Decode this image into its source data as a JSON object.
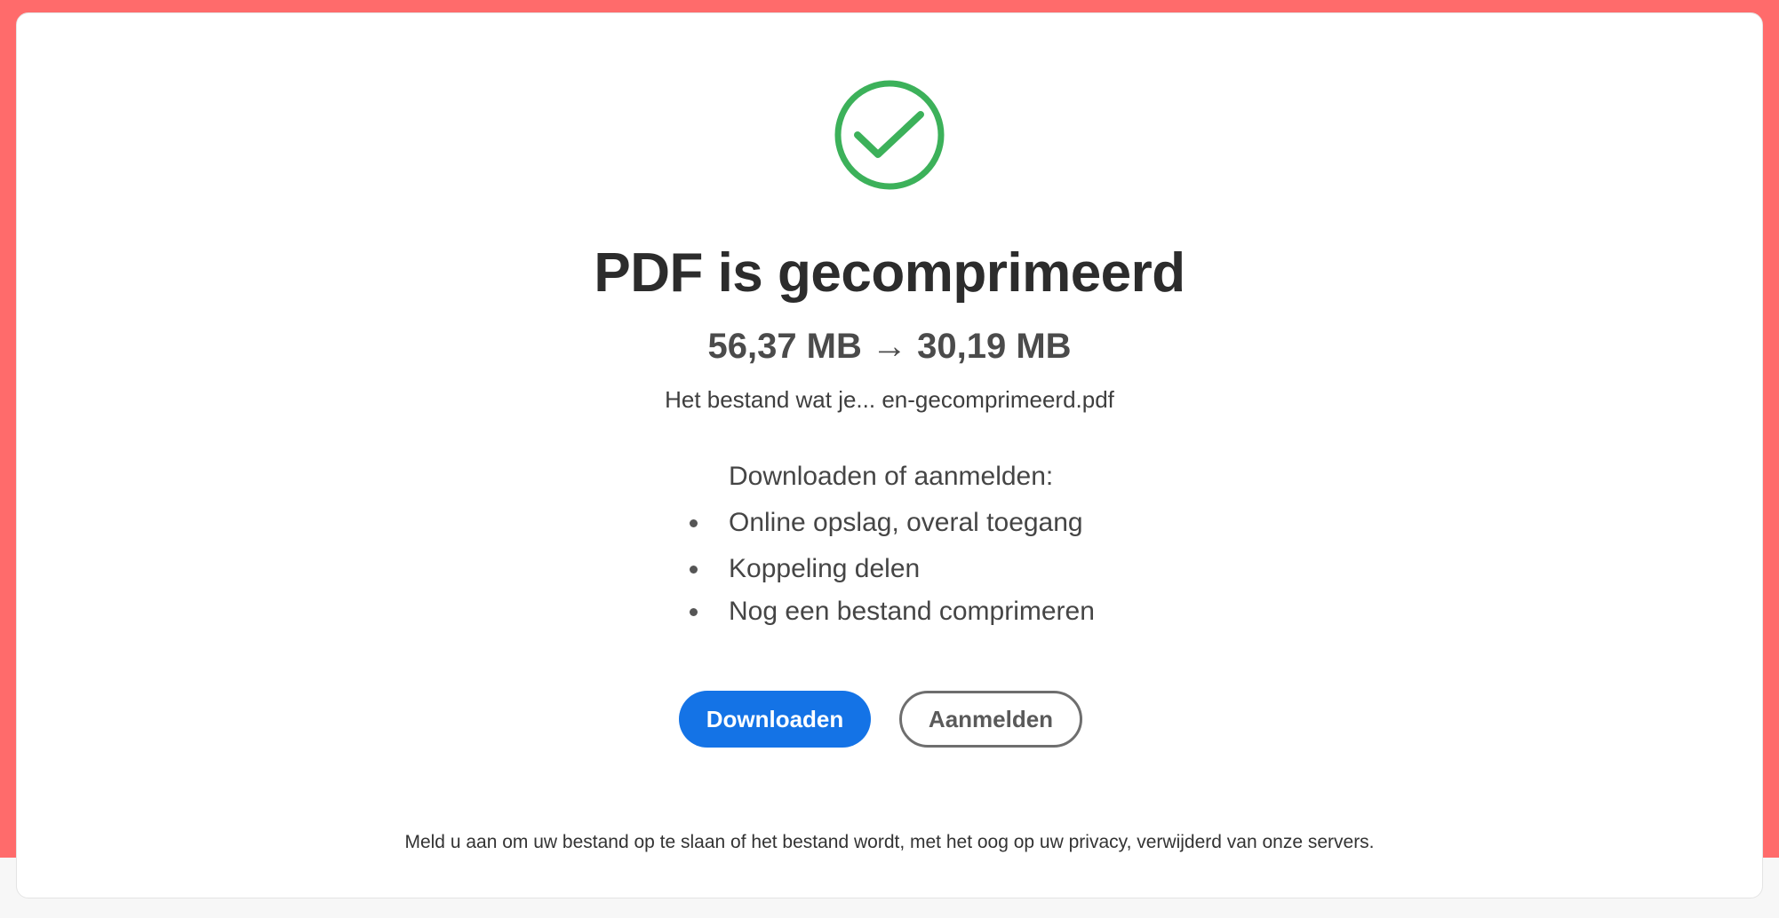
{
  "colors": {
    "background_accent": "#ff6b6b",
    "success_green": "#3cb15a",
    "primary_blue": "#1473e6"
  },
  "status": {
    "icon": "checkmark-circle-icon",
    "title": "PDF is gecomprimeerd",
    "sizes": "56,37 MB → 30,19 MB",
    "filename": "Het bestand wat je... en-gecomprimeerd.pdf"
  },
  "options": {
    "heading": "Downloaden of aanmelden:",
    "items": [
      "Online opslag, overal toegang",
      "Koppeling delen",
      "Nog een bestand comprimeren"
    ]
  },
  "actions": {
    "download_label": "Downloaden",
    "signin_label": "Aanmelden"
  },
  "footer": {
    "note": "Meld u aan om uw bestand op te slaan of het bestand wordt, met het oog op uw privacy, verwijderd van onze servers."
  }
}
